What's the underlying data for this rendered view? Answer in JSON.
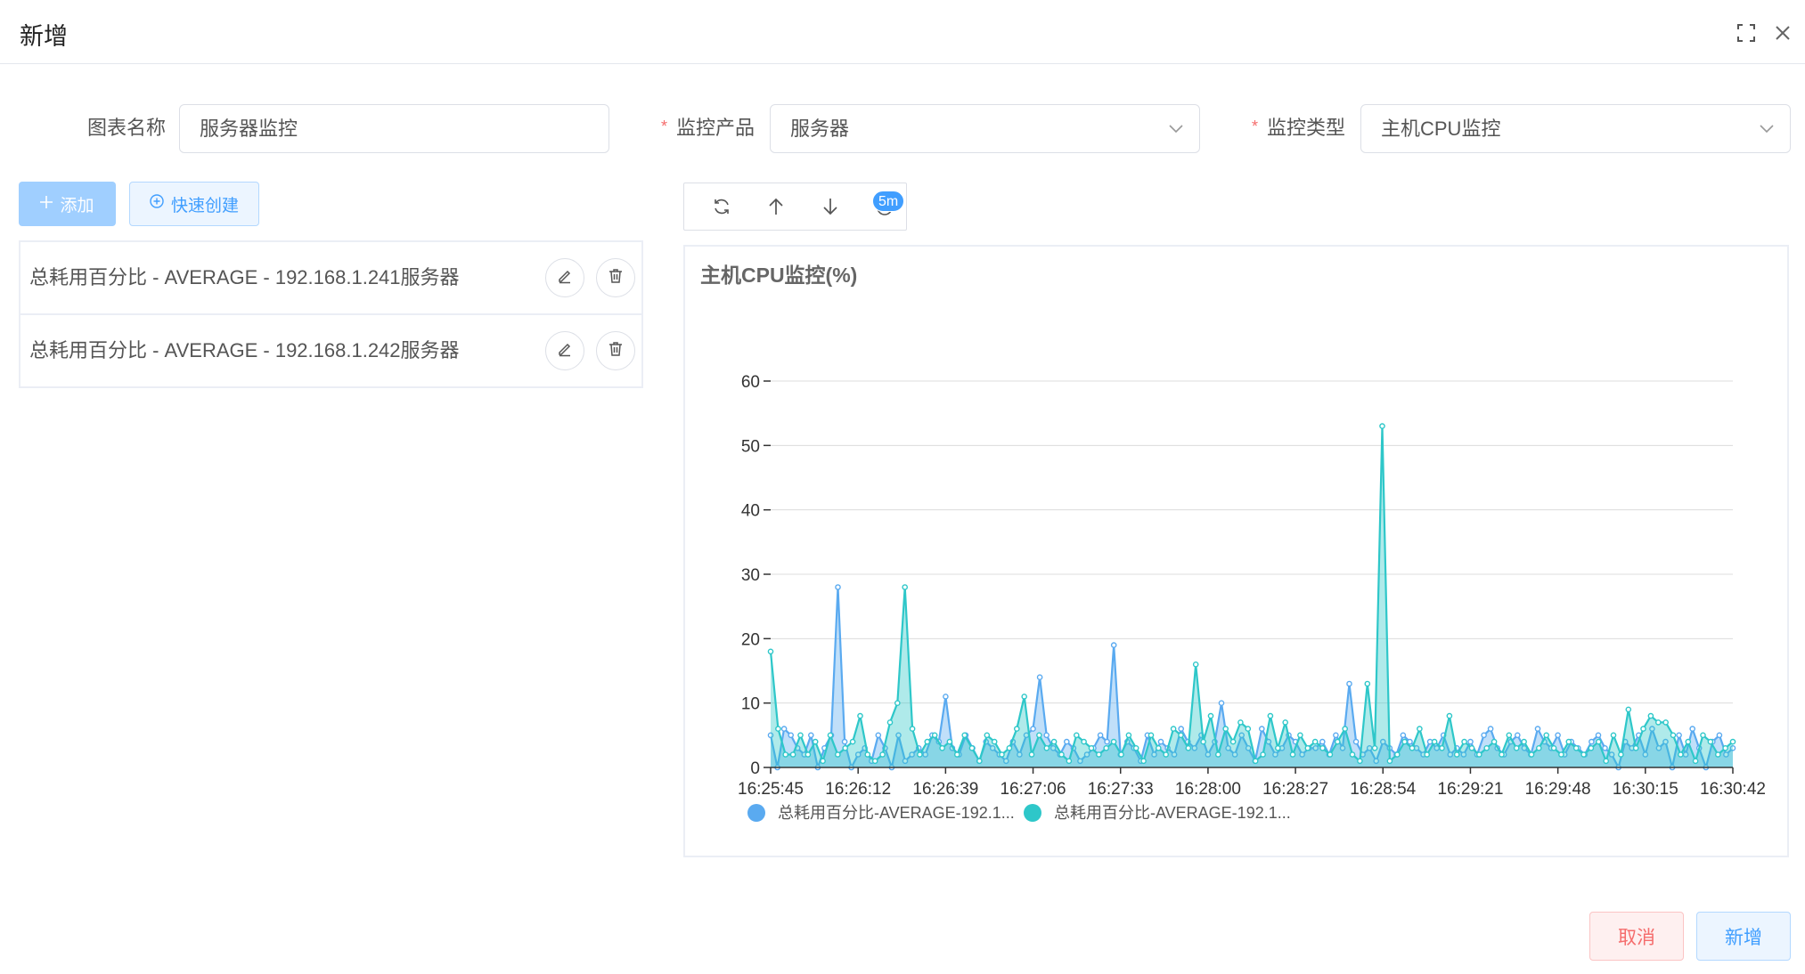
{
  "dialog": {
    "title": "新增",
    "icons": [
      "fullscreen-icon",
      "close-icon"
    ]
  },
  "form": {
    "chart_name": {
      "label": "图表名称",
      "value": "服务器监控"
    },
    "product": {
      "label": "监控产品",
      "value": "服务器",
      "required": true
    },
    "type": {
      "label": "监控类型",
      "value": "主机CPU监控",
      "required": true
    }
  },
  "actions": {
    "add_label": "添加",
    "quick_create_label": "快速创建"
  },
  "metrics": [
    {
      "label": "总耗用百分比 - AVERAGE - 192.168.1.241服务器"
    },
    {
      "label": "总耗用百分比 - AVERAGE - 192.168.1.242服务器"
    }
  ],
  "toolbar": {
    "icons": [
      "refresh-icon",
      "arrow-up-icon",
      "arrow-down-icon",
      "clock-icon"
    ],
    "interval_badge": "5m"
  },
  "chart": {
    "title": "主机CPU监控(%)"
  },
  "chart_data": {
    "type": "area",
    "title": "主机CPU监控(%)",
    "ylim": [
      0,
      60
    ],
    "yticks": [
      "0",
      "10",
      "20",
      "30",
      "40",
      "50",
      "60"
    ],
    "xticks": [
      "16:25:45",
      "16:26:12",
      "16:26:39",
      "16:27:06",
      "16:27:33",
      "16:28:00",
      "16:28:27",
      "16:28:54",
      "16:29:21",
      "16:29:48",
      "16:30:15",
      "16:30:42"
    ],
    "grid": true,
    "legend_position": "bottom-left",
    "series": [
      {
        "name": "总耗用百分比-AVERAGE-192.1...",
        "color": "#5aaaf0",
        "values": [
          5,
          0,
          6,
          5,
          3,
          2,
          5,
          0,
          3,
          5,
          28,
          4,
          0,
          2,
          3,
          1,
          5,
          3,
          0,
          5,
          1,
          2,
          3,
          2,
          5,
          4,
          11,
          3,
          2,
          5,
          3,
          1,
          4,
          3,
          2,
          1,
          4,
          2,
          5,
          6,
          14,
          5,
          3,
          2,
          4,
          3,
          1,
          2,
          3,
          5,
          4,
          19,
          2,
          4,
          3,
          1,
          5,
          2,
          4,
          3,
          2,
          6,
          4,
          3,
          5,
          2,
          4,
          10,
          3,
          2,
          5,
          3,
          1,
          6,
          4,
          2,
          3,
          5,
          4,
          2,
          3,
          3,
          4,
          2,
          5,
          3,
          13,
          4,
          2,
          3,
          1,
          4,
          3,
          2,
          5,
          4,
          3,
          2,
          4,
          3,
          5,
          2,
          3,
          2,
          4,
          2,
          5,
          6,
          3,
          2,
          4,
          5,
          3,
          2,
          6,
          4,
          3,
          5,
          2,
          4,
          3,
          2,
          4,
          5,
          3,
          2,
          0,
          4,
          3,
          5,
          2,
          6,
          3,
          4,
          0,
          5,
          2,
          6,
          3,
          0,
          4,
          5,
          2,
          3
        ]
      },
      {
        "name": "总耗用百分比-AVERAGE-192.1...",
        "color": "#2ec7c9",
        "values": [
          18,
          6,
          2,
          2,
          5,
          2,
          4,
          1,
          5,
          2,
          3,
          4,
          8,
          2,
          1,
          2,
          7,
          10,
          28,
          6,
          2,
          4,
          5,
          3,
          4,
          2,
          5,
          3,
          1,
          5,
          4,
          2,
          3,
          6,
          11,
          2,
          5,
          3,
          4,
          2,
          1,
          5,
          4,
          3,
          2,
          3,
          4,
          2,
          5,
          3,
          1,
          5,
          3,
          2,
          6,
          5,
          3,
          16,
          4,
          8,
          2,
          6,
          4,
          7,
          6,
          1,
          2,
          8,
          3,
          7,
          2,
          5,
          3,
          4,
          3,
          2,
          4,
          6,
          2,
          1,
          13,
          3,
          53,
          1,
          2,
          4,
          3,
          6,
          2,
          4,
          3,
          8,
          2,
          4,
          3,
          2,
          3,
          4,
          2,
          5,
          3,
          4,
          2,
          3,
          5,
          3,
          2,
          4,
          3,
          2,
          3,
          4,
          1,
          5,
          2,
          9,
          3,
          6,
          8,
          7,
          7,
          5,
          2,
          4,
          1,
          5,
          4,
          2,
          3,
          4
        ]
      }
    ]
  },
  "footer": {
    "cancel_label": "取消",
    "submit_label": "新增"
  }
}
